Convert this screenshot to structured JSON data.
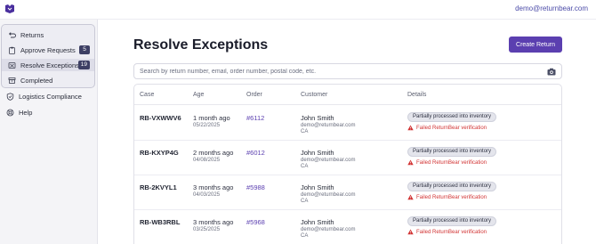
{
  "header": {
    "user_email": "demo@returnbear.com"
  },
  "sidebar": {
    "items": [
      {
        "label": "Returns",
        "icon": "return-arrow-icon"
      },
      {
        "label": "Approve Requests",
        "icon": "clipboard-icon",
        "badge": "5"
      },
      {
        "label": "Resolve Exceptions",
        "icon": "exceptions-icon",
        "badge": "19"
      },
      {
        "label": "Completed",
        "icon": "archive-icon"
      },
      {
        "label": "Logistics Compliance",
        "icon": "shield-icon"
      },
      {
        "label": "Help",
        "icon": "lifebuoy-icon"
      }
    ]
  },
  "main": {
    "title": "Resolve Exceptions",
    "create_button": "Create Return",
    "search_placeholder": "Search by return number, email, order number, postal code, etc.",
    "columns": [
      "Case",
      "Age",
      "Order",
      "Customer",
      "Details"
    ],
    "rows": [
      {
        "case": "RB-VXWWV6",
        "age": "1 month ago",
        "date": "05/22/2025",
        "order": "#6112",
        "name": "John Smith",
        "email": "demo@returnbear.com",
        "region": "CA",
        "status": "Partially processed into inventory",
        "warning": "Failed ReturnBear verification"
      },
      {
        "case": "RB-KXYP4G",
        "age": "2 months ago",
        "date": "04/08/2025",
        "order": "#6012",
        "name": "John Smith",
        "email": "demo@returnbear.com",
        "region": "CA",
        "status": "Partially processed into inventory",
        "warning": "Failed ReturnBear verification"
      },
      {
        "case": "RB-2KVYL1",
        "age": "3 months ago",
        "date": "04/03/2025",
        "order": "#5988",
        "name": "John Smith",
        "email": "demo@returnbear.com",
        "region": "CA",
        "status": "Partially processed into inventory",
        "warning": "Failed ReturnBear verification"
      },
      {
        "case": "RB-WB3RBL",
        "age": "3 months ago",
        "date": "03/25/2025",
        "order": "#5968",
        "name": "John Smith",
        "email": "demo@returnbear.com",
        "region": "CA",
        "status": "Partially processed into inventory",
        "warning": "Failed ReturnBear verification"
      }
    ]
  },
  "colors": {
    "accent": "#5b3fb0",
    "warning": "#d23434",
    "badge": "#3d3f64"
  }
}
